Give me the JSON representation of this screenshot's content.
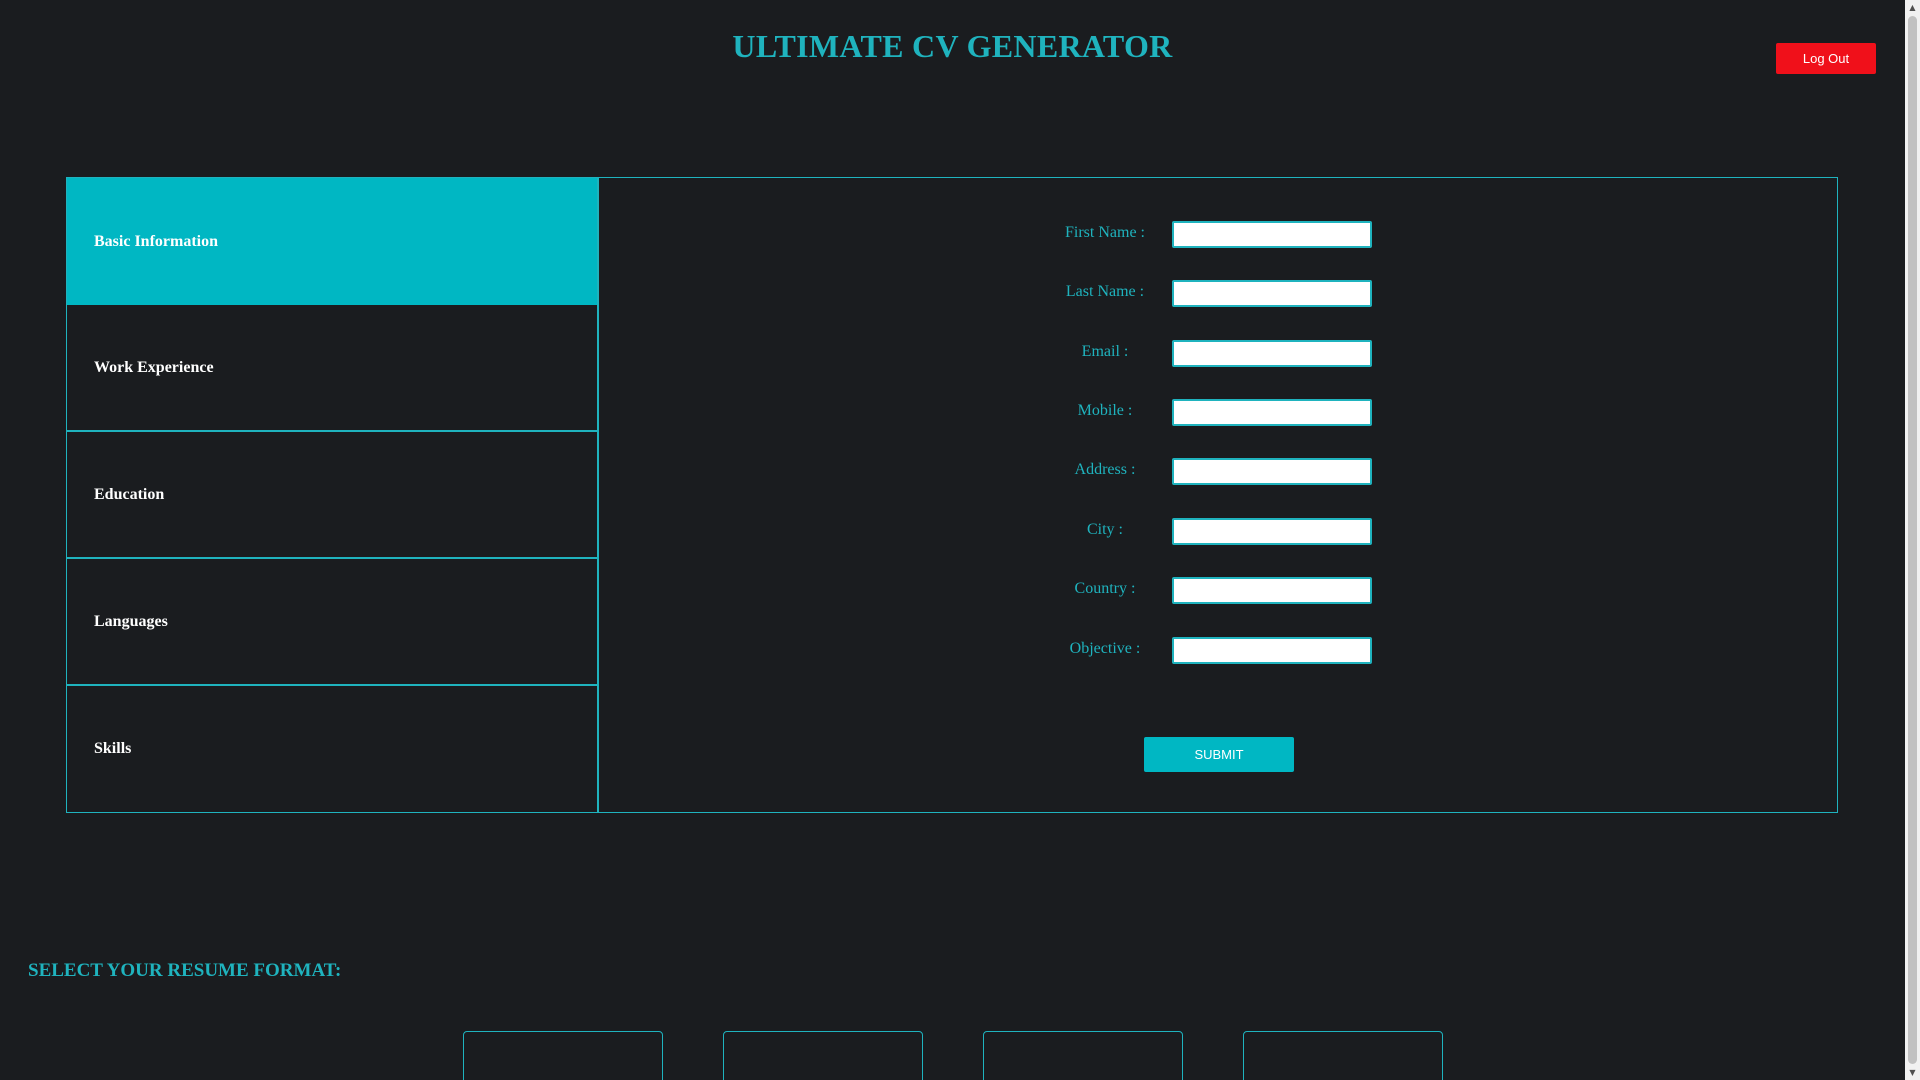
{
  "header": {
    "title": "ULTIMATE CV GENERATOR",
    "logout_label": "Log Out"
  },
  "sidebar": {
    "items": [
      {
        "label": "Basic Information",
        "active": true
      },
      {
        "label": "Work Experience",
        "active": false
      },
      {
        "label": "Education",
        "active": false
      },
      {
        "label": "Languages",
        "active": false
      },
      {
        "label": "Skills",
        "active": false
      }
    ]
  },
  "form": {
    "fields": [
      {
        "label": "First Name :",
        "value": ""
      },
      {
        "label": "Last Name :",
        "value": ""
      },
      {
        "label": "Email :",
        "value": ""
      },
      {
        "label": "Mobile :",
        "value": ""
      },
      {
        "label": "Address :",
        "value": ""
      },
      {
        "label": "City :",
        "value": ""
      },
      {
        "label": "Country :",
        "value": ""
      },
      {
        "label": "Objective :",
        "value": ""
      }
    ],
    "submit_label": "SUBMIT"
  },
  "resume_format": {
    "heading": "SELECT YOUR RESUME FORMAT:"
  },
  "colors": {
    "accent": "#1fb3be",
    "active_tab": "#00b7c3",
    "background": "#1a1c1f",
    "logout": "#f0101a"
  },
  "icons": {
    "scroll_up": "scroll-up-arrow-icon",
    "scroll_down": "scroll-down-arrow-icon"
  }
}
